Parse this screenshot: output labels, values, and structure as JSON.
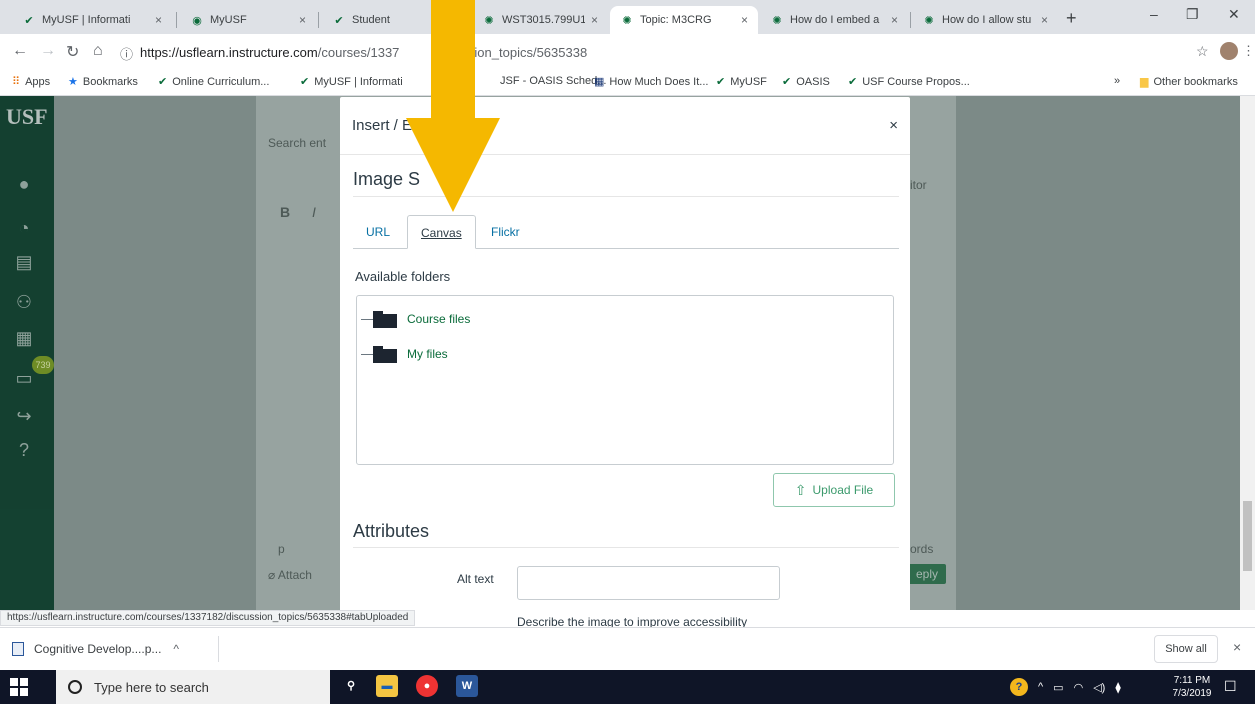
{
  "browser": {
    "tabs": [
      {
        "title": "MyUSF | Informati",
        "icon": "usf-bull-icon",
        "close": "×"
      },
      {
        "title": "MyUSF",
        "icon": "globe-icon",
        "close": "×"
      },
      {
        "title": "Student",
        "icon": "usf-bull-icon",
        "close": ""
      },
      {
        "title": "WST3015.799U19",
        "icon": "canvas-icon",
        "close": "×"
      },
      {
        "title": "Topic: M3CRG",
        "icon": "canvas-icon",
        "close": "×"
      },
      {
        "title": "How do I embed a",
        "icon": "canvas-icon",
        "close": "×"
      },
      {
        "title": "How do I allow stu",
        "icon": "canvas-icon",
        "close": "×"
      }
    ],
    "new_tab": "+",
    "window_controls": {
      "minimize": "–",
      "restore": "❐",
      "close": "✕"
    },
    "url_domain": "https://usflearn.instructure.com",
    "url_path_start": "/courses/1337",
    "url_path_end": "ssion_topics/5635338",
    "bookmarks": [
      {
        "label": "Apps",
        "icon": "apps-grid-icon"
      },
      {
        "label": "Bookmarks",
        "icon": "star-icon"
      },
      {
        "label": "Online Curriculum...",
        "icon": "usf-bull-icon"
      },
      {
        "label": "MyUSF | Informati",
        "icon": "usf-bull-icon"
      },
      {
        "label": "JSF - OASIS Sched...",
        "icon": ""
      },
      {
        "label": "How Much Does It...",
        "icon": "calendar-icon"
      },
      {
        "label": "MyUSF",
        "icon": "usf-bull-icon"
      },
      {
        "label": "OASIS",
        "icon": "usf-bull-icon"
      },
      {
        "label": "USF Course Propos...",
        "icon": "usf-bull-icon"
      }
    ],
    "bookmarks_overflow": "»",
    "other_bookmarks": "Other bookmarks"
  },
  "page": {
    "logo": "USF",
    "search_placeholder": "Search ent",
    "editor_label": "itor",
    "bold": "B",
    "italic": "I",
    "path_label": "p",
    "attach_label": "Attach",
    "words_label": "ords",
    "reply_label": "eply",
    "nav_badge": "739"
  },
  "modal": {
    "title": "Insert / Ed",
    "title_end": "e",
    "close": "×",
    "image_section": "Image S",
    "tabs": [
      {
        "label": "URL",
        "active": false
      },
      {
        "label": "Canvas",
        "active": true
      },
      {
        "label": "Flickr",
        "active": false
      }
    ],
    "folders_label": "Available folders",
    "folders": [
      "Course files",
      "My files"
    ],
    "upload_label": "Upload File",
    "attributes_title": "Attributes",
    "alt_label": "Alt text",
    "alt_value": "",
    "alt_help": "Describe the image to improve accessibility"
  },
  "status_url": "https://usflearn.instructure.com/courses/1337182/discussion_topics/5635338#tabUploaded",
  "downloads": {
    "item": "Cognitive Develop....p...",
    "chevron": "^",
    "show_all": "Show all",
    "close": "×"
  },
  "taskbar": {
    "search_placeholder": "Type here to search",
    "time": "7:11 PM",
    "date": "7/3/2019"
  },
  "colors": {
    "arrow": "#f5b800",
    "canvas_nav": "#0f3d2c",
    "link_green": "#0a6b3a"
  }
}
